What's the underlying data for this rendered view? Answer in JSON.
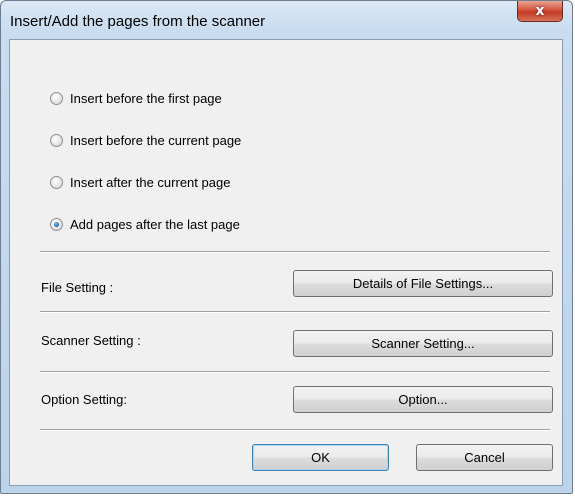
{
  "window": {
    "title": "Insert/Add the pages from the scanner",
    "close_label": "x"
  },
  "options": [
    {
      "label": "Insert before the first page",
      "checked": false
    },
    {
      "label": "Insert before the current page",
      "checked": false
    },
    {
      "label": "Insert after the current page",
      "checked": false
    },
    {
      "label": "Add pages after the last page",
      "checked": true
    }
  ],
  "file_setting": {
    "label": "File Setting :",
    "button": "Details of File Settings..."
  },
  "scanner_setting": {
    "label": "Scanner Setting :",
    "button": "Scanner Setting..."
  },
  "option_setting": {
    "label": "Option Setting:",
    "button": "Option..."
  },
  "footer": {
    "ok_label": "OK",
    "cancel_label": "Cancel"
  }
}
